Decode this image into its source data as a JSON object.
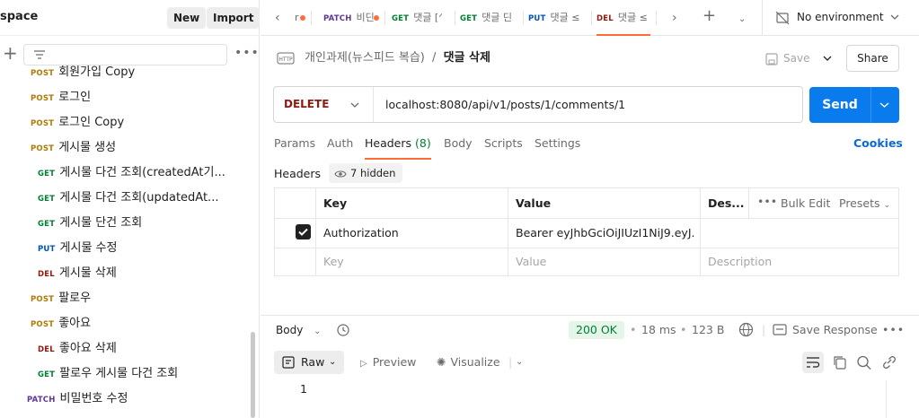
{
  "sidebar": {
    "workspace_title": "space",
    "new_label": "New",
    "import_label": "Import",
    "items": [
      {
        "method": "POST",
        "label": "회원가입 Copy"
      },
      {
        "method": "POST",
        "label": "로그인"
      },
      {
        "method": "POST",
        "label": "로그인 Copy"
      },
      {
        "method": "POST",
        "label": "게시물 생성"
      },
      {
        "method": "GET",
        "label": "게시물 다건 조회(createdAt기..."
      },
      {
        "method": "GET",
        "label": "게시물 다건 조회(updatedAt..."
      },
      {
        "method": "GET",
        "label": "게시물 단건 조회"
      },
      {
        "method": "PUT",
        "label": "게시물 수정"
      },
      {
        "method": "DEL",
        "label": "게시물 삭제"
      },
      {
        "method": "POST",
        "label": "팔로우"
      },
      {
        "method": "POST",
        "label": "좋아요"
      },
      {
        "method": "DEL",
        "label": "좋아요 삭제"
      },
      {
        "method": "GET",
        "label": "팔로우 게시물 다건 조회"
      },
      {
        "method": "PATCH",
        "label": "비밀번호 수정"
      }
    ]
  },
  "tabs": [
    {
      "method": "",
      "label": "r"
    },
    {
      "method": "PATCH",
      "label": "비딘"
    },
    {
      "method": "GET",
      "label": "댓글 [ᐟ"
    },
    {
      "method": "GET",
      "label": "댓글 딘"
    },
    {
      "method": "PUT",
      "label": "댓글 ≤"
    },
    {
      "method": "DEL",
      "label": "댓글 ≤"
    }
  ],
  "environment": "No environment",
  "breadcrumb": {
    "collection": "개인과제(뉴스피드 복습)",
    "separator": "/",
    "request": "댓글 삭제"
  },
  "save_label": "Save",
  "share_label": "Share",
  "request": {
    "method": "DELETE",
    "url": "localhost:8080/api/v1/posts/1/comments/1",
    "send_label": "Send"
  },
  "req_tabs": {
    "params": "Params",
    "auth": "Auth",
    "headers": "Headers",
    "headers_count": "(8)",
    "body": "Body",
    "scripts": "Scripts",
    "settings": "Settings",
    "cookies": "Cookies"
  },
  "headers_section": {
    "title": "Headers",
    "hidden": "7 hidden"
  },
  "table": {
    "col_key": "Key",
    "col_value": "Value",
    "col_desc": "Des...",
    "bulk_edit": "Bulk Edit",
    "presets": "Presets",
    "row_key": "Authorization",
    "row_value": "Bearer eyJhbGciOiJIUzI1NiJ9.eyJ...",
    "ph_key": "Key",
    "ph_value": "Value",
    "ph_desc": "Description"
  },
  "response": {
    "body_label": "Body",
    "status": "200 OK",
    "time": "18 ms",
    "size": "123 B",
    "save_response": "Save Response",
    "raw": "Raw",
    "preview": "Preview",
    "visualize": "Visualize",
    "line_number": "1"
  },
  "colors": {
    "accent": "#ff6c37",
    "send": "#097bed",
    "post": "#ad7a03",
    "get": "#007f31",
    "put": "#0053b8",
    "del": "#8e1a10",
    "patch": "#623497"
  }
}
